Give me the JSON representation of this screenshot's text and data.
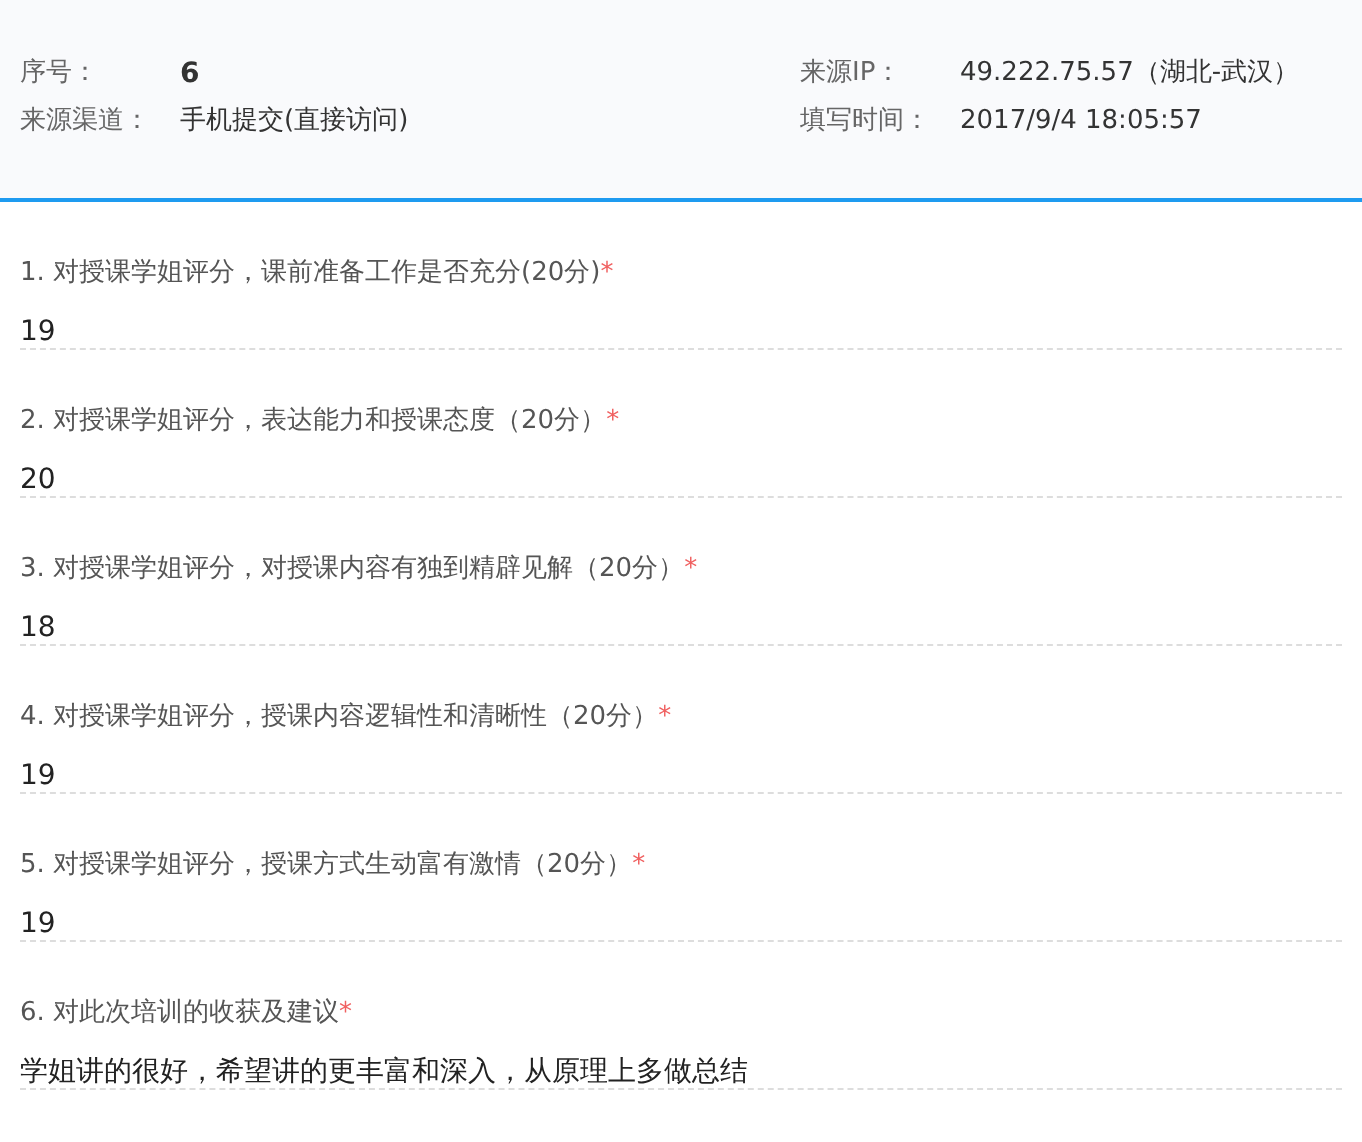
{
  "header": {
    "fields": [
      {
        "label": "序号：",
        "value": "6",
        "bold": true
      },
      {
        "label": "来源IP：",
        "value": "49.222.75.57（湖北-武汉）",
        "bold": false
      },
      {
        "label": "来源渠道：",
        "value": "手机提交(直接访问)",
        "bold": false
      },
      {
        "label": "填写时间：",
        "value": "2017/9/4 18:05:57",
        "bold": false
      }
    ]
  },
  "questions": [
    {
      "title": "1. 对授课学姐评分，课前准备工作是否充分(20分)",
      "required": "*",
      "answer": "19"
    },
    {
      "title": "2. 对授课学姐评分，表达能力和授课态度（20分）",
      "required": "*",
      "answer": "20"
    },
    {
      "title": "3. 对授课学姐评分，对授课内容有独到精辟见解（20分）",
      "required": "*",
      "answer": "18"
    },
    {
      "title": "4. 对授课学姐评分，授课内容逻辑性和清晰性（20分）",
      "required": "*",
      "answer": "19"
    },
    {
      "title": "5. 对授课学姐评分，授课方式生动富有激情（20分）",
      "required": "*",
      "answer": "19"
    },
    {
      "title": "6. 对此次培训的收获及建议",
      "required": "*",
      "answer": "学姐讲的很好，希望讲的更丰富和深入，从原理上多做总结"
    }
  ]
}
